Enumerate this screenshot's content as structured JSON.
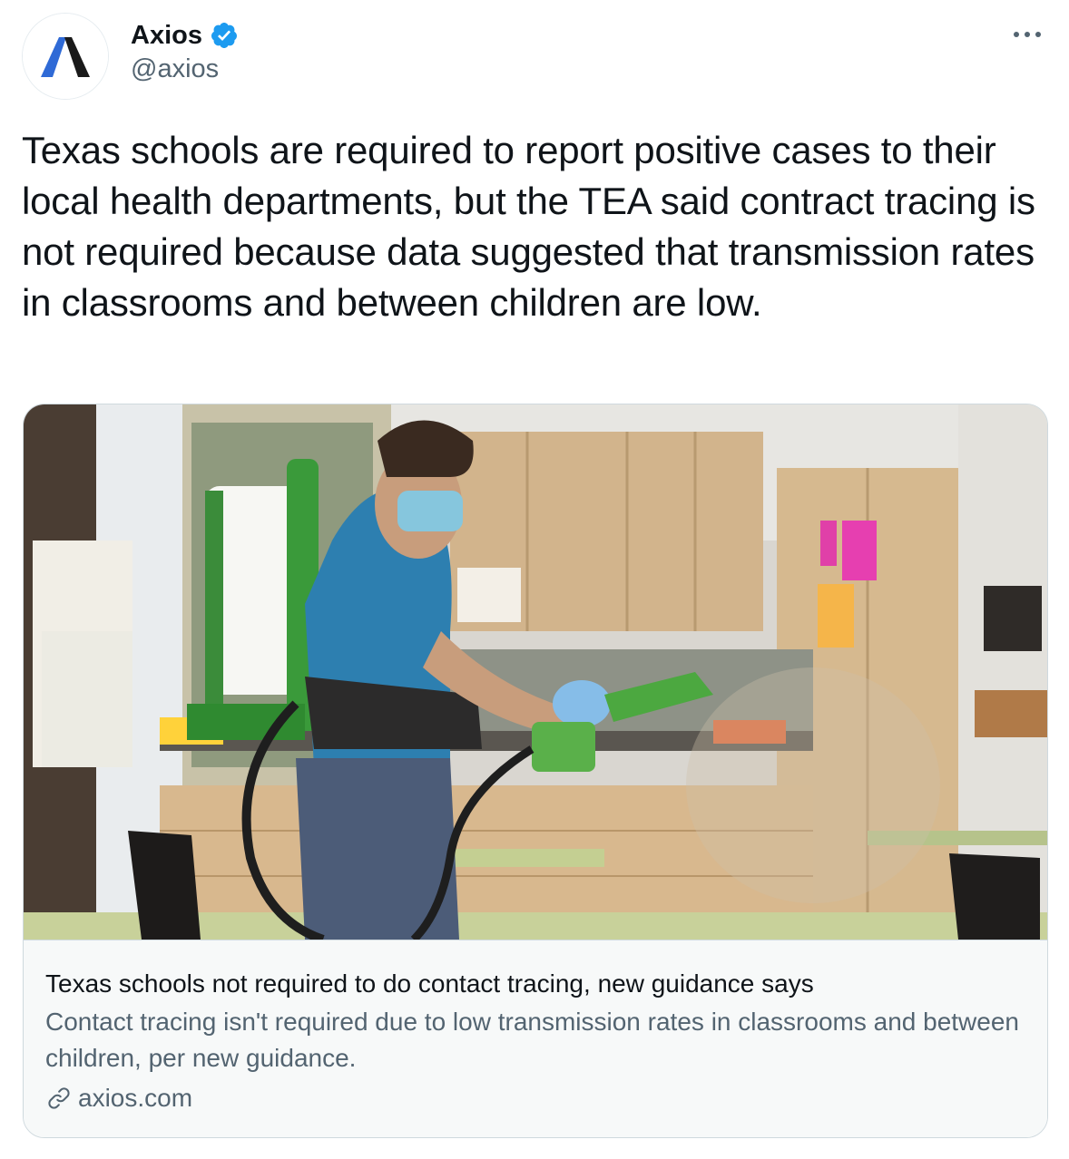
{
  "author": {
    "display_name": "Axios",
    "handle": "@axios",
    "verified": true,
    "avatar_icon": "axios-logo-icon"
  },
  "actions": {
    "more_icon": "more-horizontal-icon"
  },
  "tweet": {
    "text": "Texas schools are required to report positive cases to their local health departments, but the TEA said contract tracing is not required because data suggested that transmission rates in classrooms and between children are low."
  },
  "link_card": {
    "image_description_icon": "card-photo",
    "title": "Texas schools not required to do contact tracing, new guidance says",
    "description": "Contact tracing isn't required due to low transmission rates in classrooms and between children, per new guidance.",
    "domain": "axios.com",
    "domain_icon": "link-icon"
  },
  "colors": {
    "text_primary": "#0f1419",
    "text_secondary": "#536471",
    "verified_blue": "#1d9bf0",
    "card_border": "#cfd9de",
    "card_footer_bg": "#f7f9f9"
  }
}
